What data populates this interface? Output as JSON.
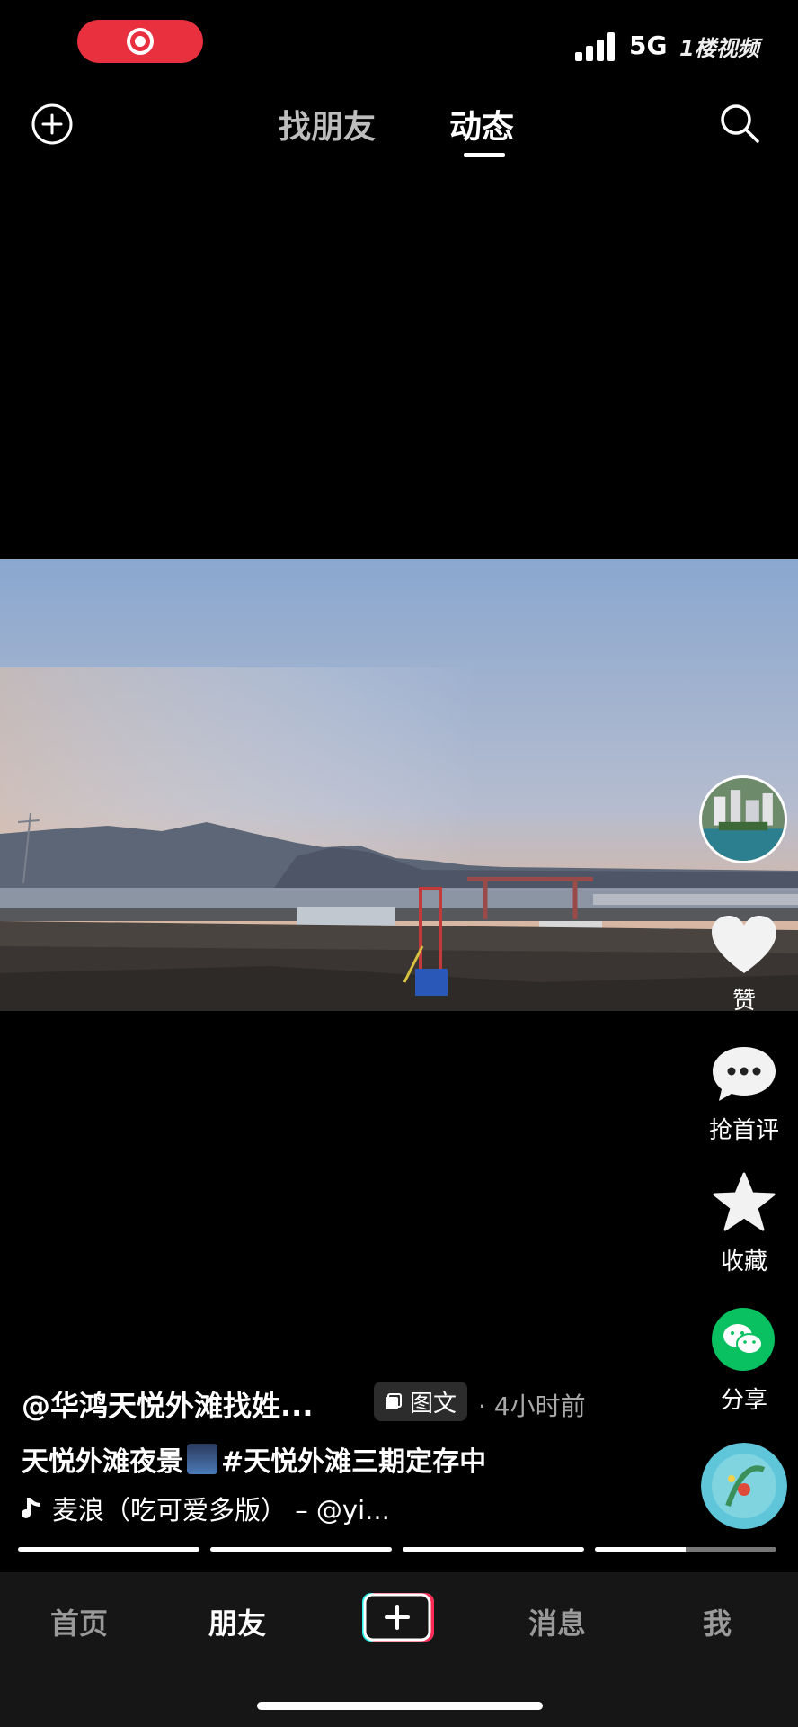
{
  "status_bar": {
    "network": "5G",
    "watermark": "1楼视频"
  },
  "top_nav": {
    "tabs": [
      {
        "label": "找朋友",
        "active": false
      },
      {
        "label": "动态",
        "active": true
      }
    ]
  },
  "side_actions": {
    "like_label": "赞",
    "comment_label": "抢首评",
    "favorite_label": "收藏",
    "share_label": "分享"
  },
  "post": {
    "author": "@华鸿天悦外滩找姓...",
    "type_badge": "图文",
    "time": "· 4小时前",
    "caption_before_emoji": "天悦外滩夜景",
    "caption_after_emoji": "#天悦外滩三期定存中",
    "music": "麦浪（吃可爱多版） – @yi..."
  },
  "progress": {
    "segments": [
      1,
      1,
      1,
      0.5
    ]
  },
  "bottom_nav": {
    "home": "首页",
    "friends": "朋友",
    "messages": "消息",
    "me": "我"
  },
  "colors": {
    "record": "#e8303f",
    "share_green": "#09c160",
    "bottom_bar": "#161616"
  }
}
